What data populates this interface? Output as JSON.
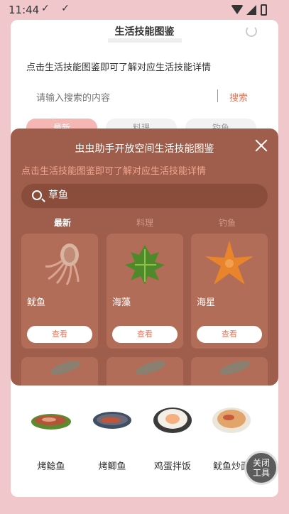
{
  "status_bar": {
    "time": "11:44",
    "left_icons": "✓ ✓"
  },
  "page": {
    "title": "生活技能图鉴",
    "description": "点击生活技能图鉴即可了解对应生活技能详情",
    "search": {
      "placeholder": "请输入搜索的内容",
      "button": "搜索"
    },
    "tabs": [
      {
        "label": "最新"
      },
      {
        "label": "料理"
      },
      {
        "label": "钓鱼"
      }
    ],
    "foods": [
      {
        "label": "烤鲶鱼",
        "icon": "grilled-catfish"
      },
      {
        "label": "烤鲫鱼",
        "icon": "grilled-crucian"
      },
      {
        "label": "鸡蛋拌饭",
        "icon": "egg-rice"
      },
      {
        "label": "鱿鱼炒面",
        "icon": "squid-noodles"
      }
    ]
  },
  "overlay": {
    "title": "虫虫助手开放空间生活技能图鉴",
    "description": "点击生活技能图鉴即可了解对应生活技能详情",
    "search_value": "草鱼",
    "tabs": [
      {
        "label": "最新"
      },
      {
        "label": "料理"
      },
      {
        "label": "钓鱼"
      }
    ],
    "cards": [
      {
        "name": "鱿鱼",
        "button": "查看",
        "icon": "squid"
      },
      {
        "name": "海藻",
        "button": "查看",
        "icon": "seaweed"
      },
      {
        "name": "海星",
        "button": "查看",
        "icon": "starfish"
      }
    ]
  },
  "float_button": {
    "line1": "关闭",
    "line2": "工具"
  },
  "colors": {
    "overlay_bg": "#9f5e4b",
    "card_bg": "#b26d58",
    "accent": "#e07a5f",
    "page_bg": "#f0c8cc"
  }
}
